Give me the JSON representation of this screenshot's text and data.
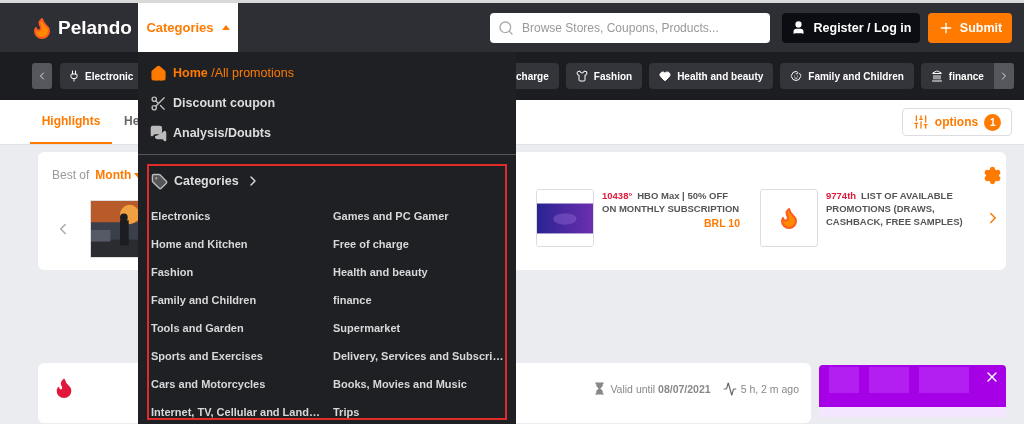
{
  "header": {
    "logo": "Pelando",
    "categories_menu": {
      "label": "Categories",
      "expanded": true
    },
    "search": {
      "placeholder": "Browse Stores, Coupons, Products..."
    },
    "login_button": "Register / Log in",
    "submit_button": "Submit"
  },
  "category_chips": {
    "left": [
      {
        "label": "Electronic",
        "kind": "electronics"
      }
    ],
    "right": [
      {
        "label": "charge",
        "kind": "plain"
      },
      {
        "label": "Fashion",
        "kind": "fashion"
      },
      {
        "label": "Health and beauty",
        "kind": "health"
      },
      {
        "label": "Family and Children",
        "kind": "family"
      },
      {
        "label": "finance",
        "kind": "finance"
      }
    ]
  },
  "tabs": [
    {
      "label": "Highlights",
      "selected": true
    },
    {
      "label": "He",
      "selected": false
    }
  ],
  "options_button": {
    "label": "options",
    "badge": "1"
  },
  "best_of": {
    "label": "Best of",
    "period": "Month"
  },
  "featured": [
    {
      "rank": "10438°",
      "title": "HBO Max | 50% OFF ON MONTHLY SUBSCRIPTION",
      "price": "BRL 10",
      "kind": "video"
    },
    {
      "rank": "9774th",
      "title": "LIST OF AVAILABLE PROMOTIONS (DRAWS, CASHBACK, FREE SAMPLES)",
      "kind": "brand"
    }
  ],
  "deal": {
    "valid": "Valid until **08/07/2021**",
    "age": "5 h, 2 m ago"
  },
  "menu": {
    "links": [
      {
        "label": "**Home** /All promotions",
        "kind": "home",
        "selected": true
      },
      {
        "label": "Discount coupon",
        "kind": "coupon",
        "selected": false
      },
      {
        "label": "Analysis/Doubts",
        "kind": "chat",
        "selected": false
      }
    ],
    "categories_title": "Categories",
    "categories": [
      "Electronics",
      "Games and PC Gamer",
      "Home and Kitchen",
      "Free of charge",
      "Fashion",
      "Health and beauty",
      "Family and Children",
      "finance",
      "Tools and Garden",
      "Supermarket",
      "Sports and Exercises",
      "Delivery, Services and Subscri…",
      "Cars and Motorcycles",
      "Books, Movies and Music",
      "Internet, TV, Cellular and Land…",
      "Trips"
    ]
  }
}
